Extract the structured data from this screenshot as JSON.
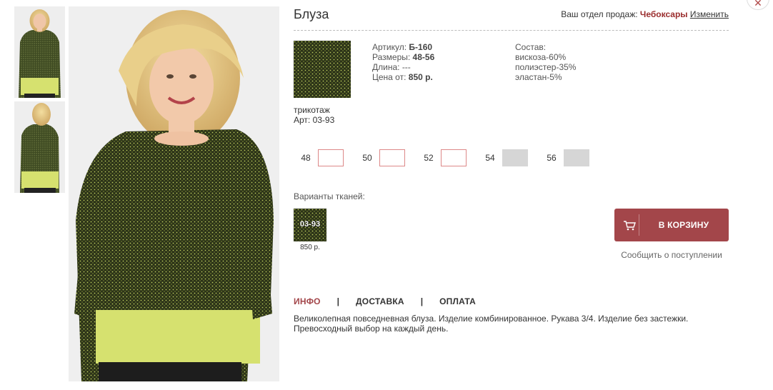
{
  "product": {
    "title": "Блуза",
    "article": "Б-160",
    "sizes_range": "48-56",
    "length": "---",
    "price_from": "850 р."
  },
  "labels": {
    "article": "Артикул: ",
    "sizes": "Размеры: ",
    "length": "Длина: ",
    "price": "Цена от: ",
    "composition": "Состав:"
  },
  "sales_dept": {
    "label": "Ваш отдел продаж: ",
    "city": "Чебоксары",
    "change": "Изменить"
  },
  "composition": [
    "вискоза-60%",
    "полиэстер-35%",
    "эластан-5%"
  ],
  "fabric": {
    "name": "трикотаж",
    "article": "Арт: 03-93"
  },
  "sizes": [
    {
      "label": "48",
      "available": true
    },
    {
      "label": "50",
      "available": true
    },
    {
      "label": "52",
      "available": true
    },
    {
      "label": "54",
      "available": false
    },
    {
      "label": "56",
      "available": false
    }
  ],
  "variants": {
    "label": "Варианты тканей:",
    "items": [
      {
        "code": "03-93",
        "price": "850 р."
      }
    ]
  },
  "cart": {
    "label": "В КОРЗИНУ",
    "icon": "cart-icon"
  },
  "notify": "Сообщить о поступлении",
  "tabs": [
    {
      "label": "ИНФО",
      "active": true
    },
    {
      "label": "ДОСТАВКА",
      "active": false
    },
    {
      "label": "ОПЛАТА",
      "active": false
    }
  ],
  "tab_separator": "|",
  "description": "Великолепная повседневная блуза. Изделие комбинированное. Рукава 3/4. Изделие без застежки. Превосходный выбор на каждый день.",
  "close_icon": "close-icon",
  "colors": {
    "accent": "#a3464a",
    "city": "#9a2d2d",
    "fabric_dark": "#2c3318",
    "fabric_dot": "#b8c85a",
    "blouse_green": "#3e4a22",
    "hem_lime": "#d6e16f"
  }
}
